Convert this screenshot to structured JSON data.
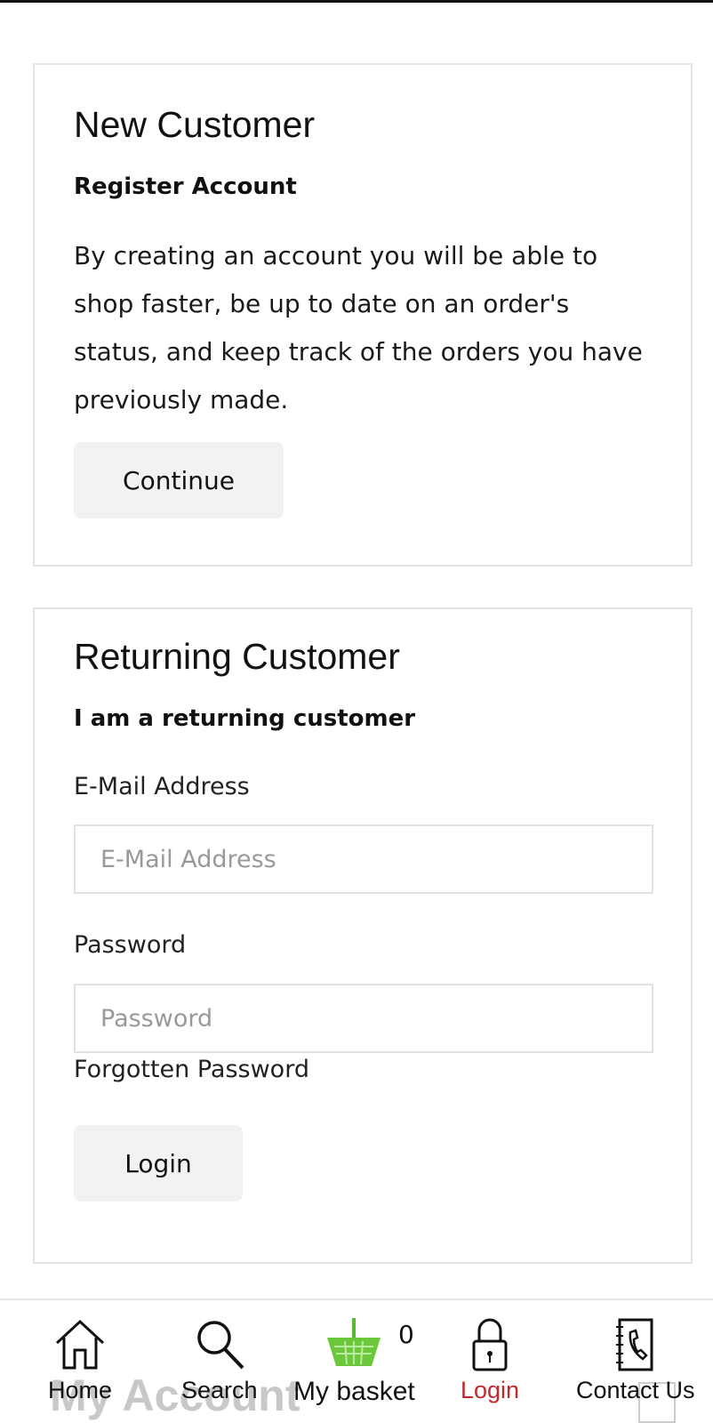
{
  "new_customer": {
    "title": "New Customer",
    "subtitle": "Register Account",
    "description": "By creating an account you will be able to shop faster, be up to date on an order's status, and keep track of the orders you have previously made.",
    "continue_label": "Continue"
  },
  "returning_customer": {
    "title": "Returning Customer",
    "subtitle": "I am a returning customer",
    "email_label": "E-Mail Address",
    "email_placeholder": "E-Mail Address",
    "email_value": "",
    "password_label": "Password",
    "password_placeholder": "Password",
    "password_value": "",
    "forgotten_label": "Forgotten Password",
    "login_label": "Login"
  },
  "nav": {
    "items": [
      {
        "label": "Home",
        "icon": "home-icon"
      },
      {
        "label": "Search",
        "icon": "search-icon"
      },
      {
        "label": "My basket",
        "icon": "basket-icon"
      },
      {
        "label": "Login",
        "icon": "lock-icon",
        "active": true
      },
      {
        "label": "Contact Us",
        "icon": "phone-book-icon"
      }
    ],
    "basket_count": "0",
    "ghost_title": "My Account",
    "active_color": "#c0282d",
    "basket_color": "#5cb82e"
  }
}
